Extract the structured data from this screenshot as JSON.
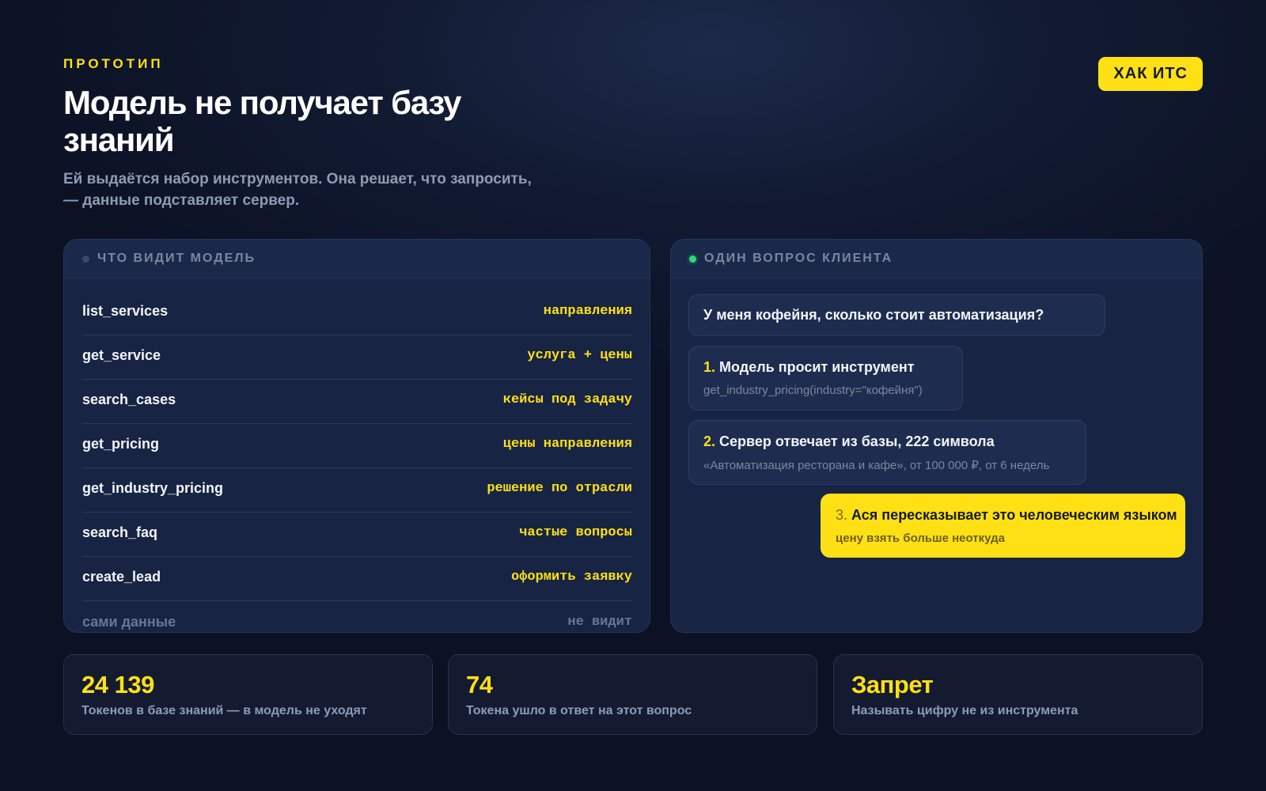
{
  "header": {
    "eyebrow": "ПРОТОТИП",
    "title": "Модель не получает базу знаний",
    "subtitle": "Ей выдаётся набор инструментов. Она решает, что запросить, — данные подставляет сервер.",
    "badge": "ХАК ИТС"
  },
  "left_panel": {
    "title": "ЧТО ВИДИТ МОДЕЛЬ",
    "rows": [
      {
        "name": "list_services",
        "desc": "направления"
      },
      {
        "name": "get_service",
        "desc": "услуга + цены"
      },
      {
        "name": "search_cases",
        "desc": "кейсы под задачу"
      },
      {
        "name": "get_pricing",
        "desc": "цены направления"
      },
      {
        "name": "get_industry_pricing",
        "desc": "решение по отрасли"
      },
      {
        "name": "search_faq",
        "desc": "частые вопросы"
      },
      {
        "name": "create_lead",
        "desc": "оформить заявку"
      },
      {
        "name": "сами данные",
        "desc": "не видит"
      }
    ]
  },
  "right_panel": {
    "title": "ОДИН ВОПРОС КЛИЕНТА",
    "question": "У меня кофейня, сколько стоит автоматизация?",
    "steps": [
      {
        "num": "1.",
        "title": "Модель просит инструмент",
        "sub": "get_industry_pricing(industry=\"кофейня\")"
      },
      {
        "num": "2.",
        "title": "Сервер отвечает из базы, 222 символа",
        "sub": "«Автоматизация ресторана и кафе», от 100 000 ₽, от 6 недель"
      },
      {
        "num": "3.",
        "title": "Ася пересказывает это человеческим языком",
        "sub": "цену взять больше неоткуда"
      }
    ]
  },
  "stats": [
    {
      "value": "24 139",
      "label": "Токенов в базе знаний — в модель не уходят"
    },
    {
      "value": "74",
      "label": "Токена ушло в ответ на этот вопрос"
    },
    {
      "value": "Запрет",
      "label": "Называть цифру не из инструмента"
    }
  ],
  "colors": {
    "accent": "#ffe014",
    "background": "#121b33",
    "panel": "#172443",
    "status_dot": "#2bd97a"
  }
}
